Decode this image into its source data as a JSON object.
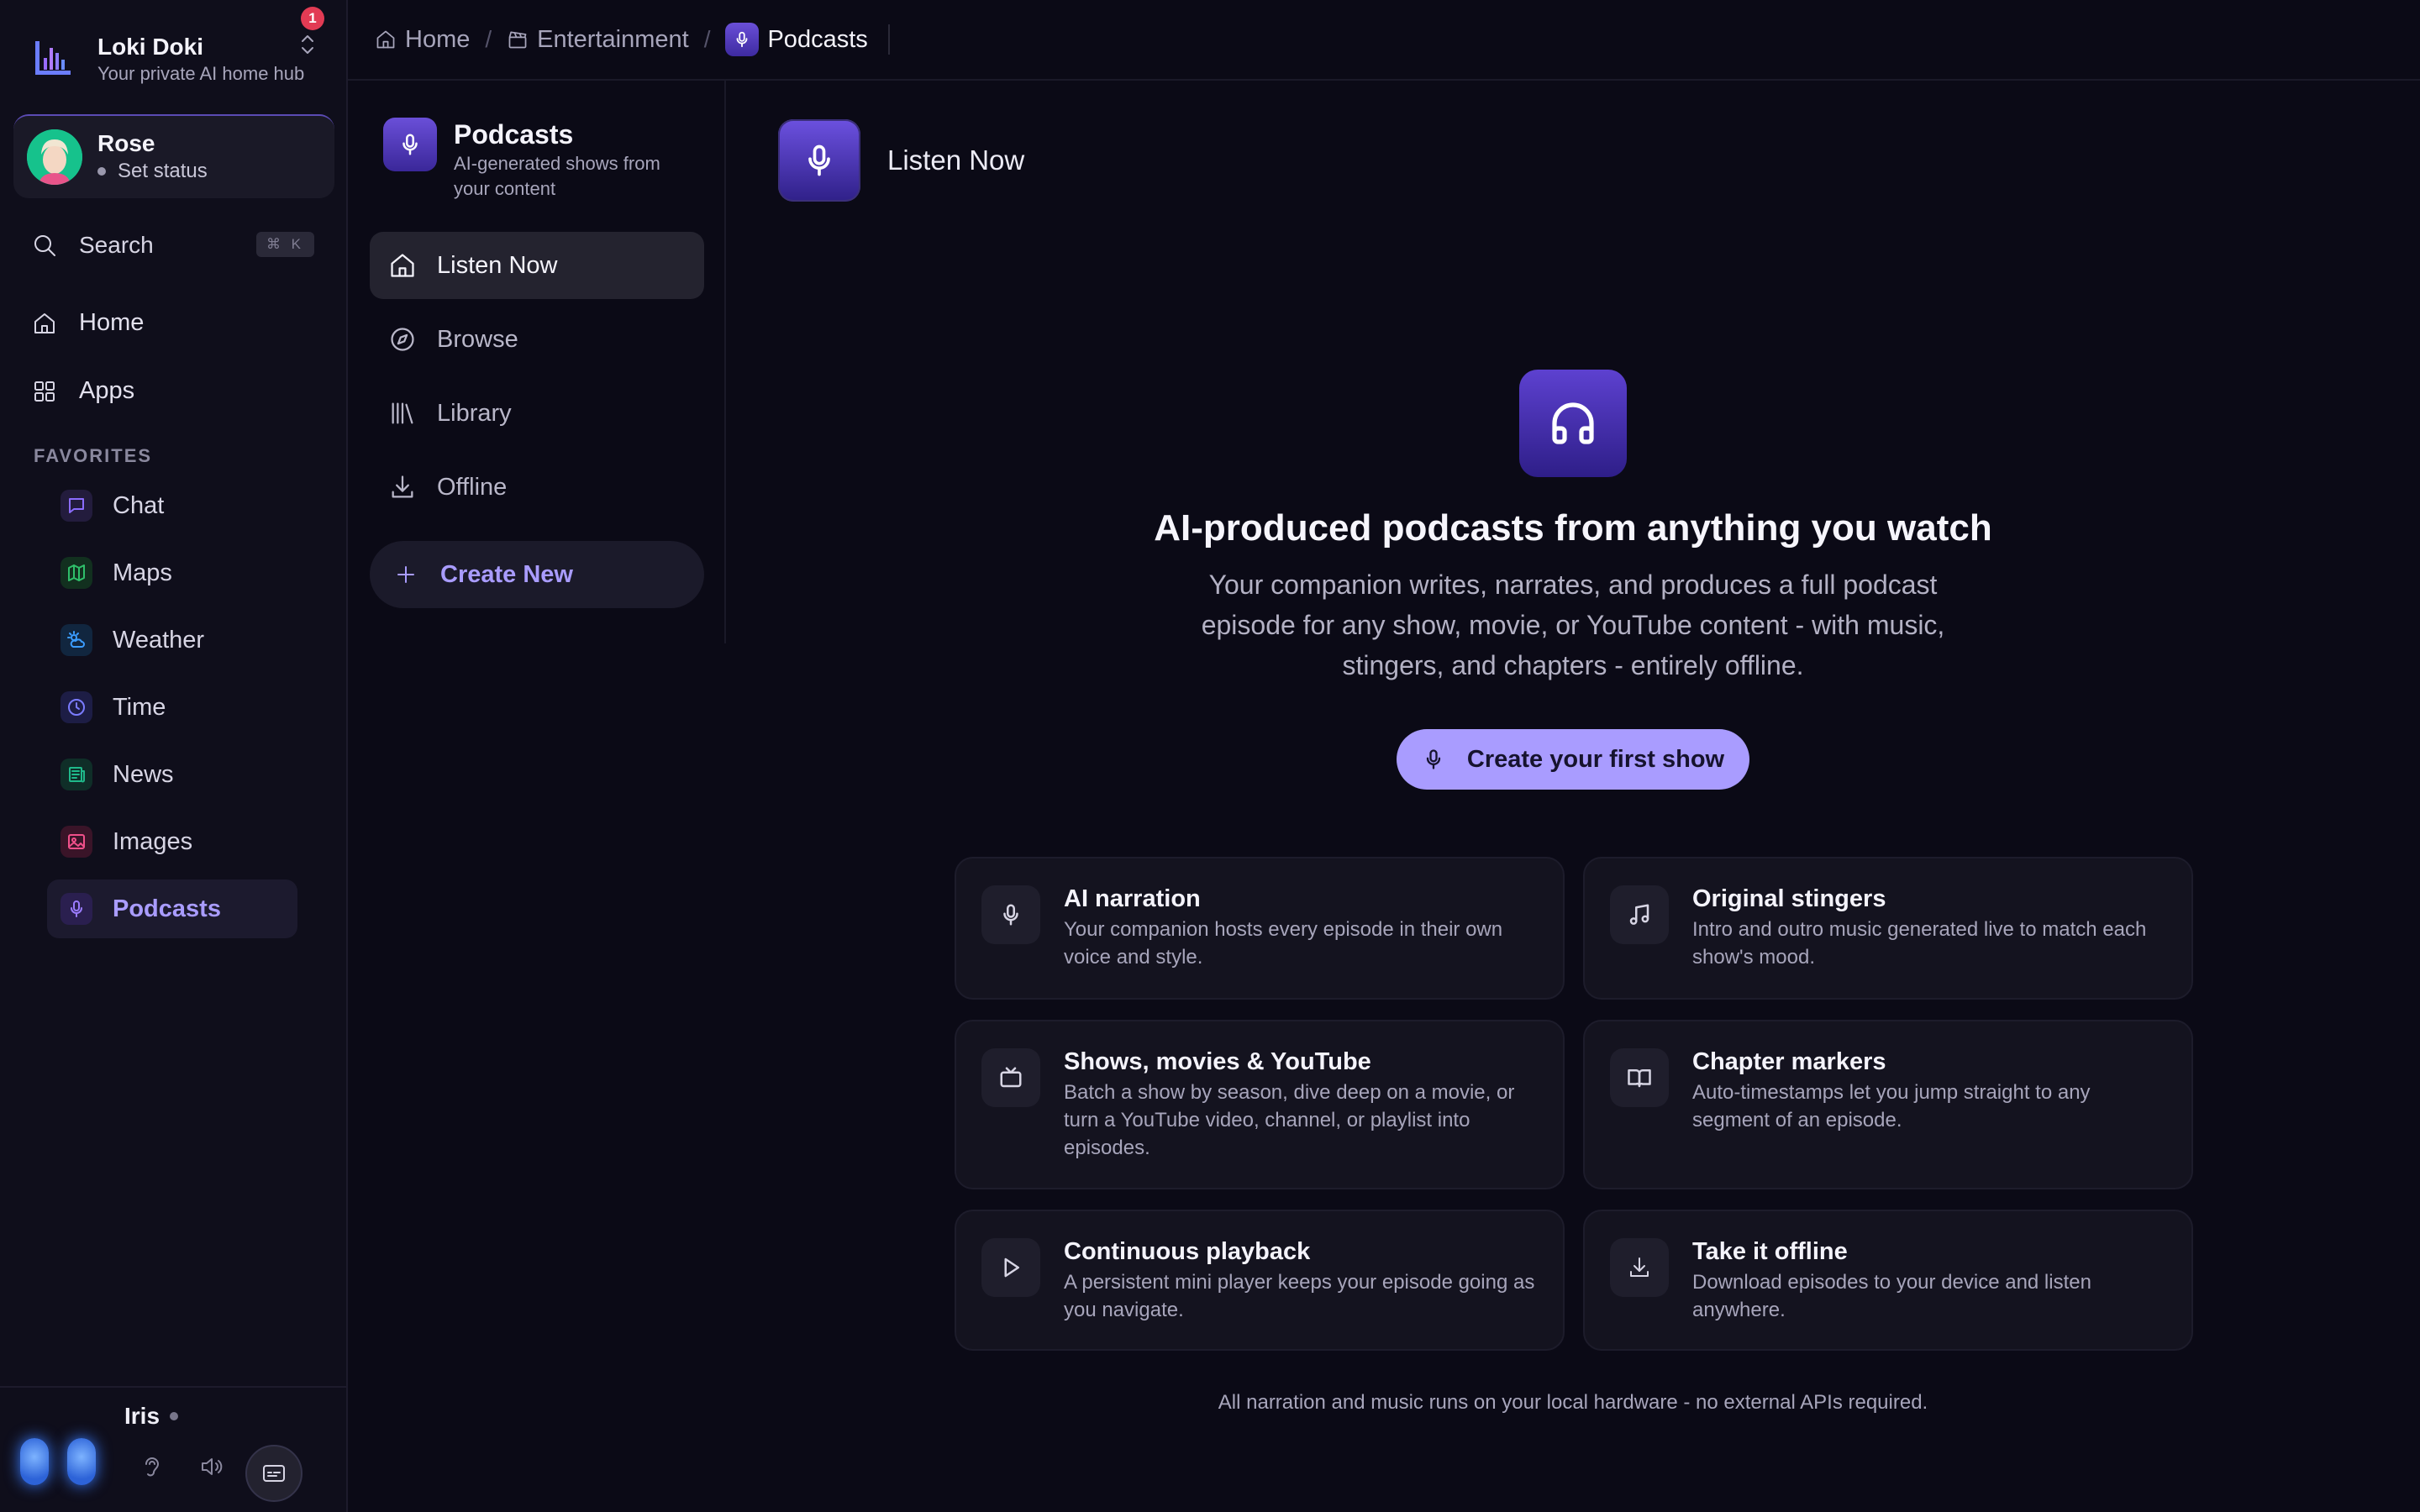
{
  "brand": {
    "title": "Loki Doki",
    "subtitle": "Your private AI home hub"
  },
  "user": {
    "name": "Rose",
    "status": "Set status",
    "notifications": "1"
  },
  "search": {
    "label": "Search",
    "shortcut": "⌘ K"
  },
  "nav": {
    "home": "Home",
    "apps": "Apps"
  },
  "favorites": {
    "heading": "FAVORITES",
    "items": [
      {
        "label": "Chat",
        "icon": "chat-icon",
        "color": "#8b6cff"
      },
      {
        "label": "Maps",
        "icon": "map-icon",
        "color": "#2fbf6a"
      },
      {
        "label": "Weather",
        "icon": "weather-icon",
        "color": "#3b9cff"
      },
      {
        "label": "Time",
        "icon": "clock-icon",
        "color": "#7b7cff"
      },
      {
        "label": "News",
        "icon": "newspaper-icon",
        "color": "#1fb98a"
      },
      {
        "label": "Images",
        "icon": "image-icon",
        "color": "#f0508a"
      },
      {
        "label": "Podcasts",
        "icon": "microphone-icon",
        "color": "#9b7cff"
      }
    ]
  },
  "assistant": {
    "name": "Iris"
  },
  "breadcrumb": {
    "items": [
      "Home",
      "Entertainment",
      "Podcasts"
    ]
  },
  "podcasts_panel": {
    "title": "Podcasts",
    "subtitle": "AI-generated shows from your content",
    "items": [
      "Listen Now",
      "Browse",
      "Library",
      "Offline"
    ],
    "create": "Create New"
  },
  "main": {
    "title": "Listen Now",
    "hero_title": "AI-produced podcasts from anything you watch",
    "hero_text": "Your companion writes, narrates, and produces a full podcast episode for any show, movie, or YouTube content - with music, stingers, and chapters - entirely offline.",
    "cta": "Create your first show",
    "features": [
      {
        "title": "AI narration",
        "text": "Your companion hosts every episode in their own voice and style.",
        "icon": "microphone-icon"
      },
      {
        "title": "Original stingers",
        "text": "Intro and outro music generated live to match each show's mood.",
        "icon": "music-note-icon"
      },
      {
        "title": "Shows, movies & YouTube",
        "text": "Batch a show by season, dive deep on a movie, or turn a YouTube video, channel, or playlist into episodes.",
        "icon": "tv-icon"
      },
      {
        "title": "Chapter markers",
        "text": "Auto-timestamps let you jump straight to any segment of an episode.",
        "icon": "book-icon"
      },
      {
        "title": "Continuous playback",
        "text": "A persistent mini player keeps your episode going as you navigate.",
        "icon": "play-icon"
      },
      {
        "title": "Take it offline",
        "text": "Download episodes to your device and listen anywhere.",
        "icon": "download-icon"
      }
    ],
    "footnote": "All narration and music runs on your local hardware - no external APIs required."
  },
  "colors": {
    "accent": "#a99cff",
    "background": "#0b0a16",
    "sidebar": "#0f0e1b",
    "card": "#14131f",
    "badge": "#e23b54"
  }
}
